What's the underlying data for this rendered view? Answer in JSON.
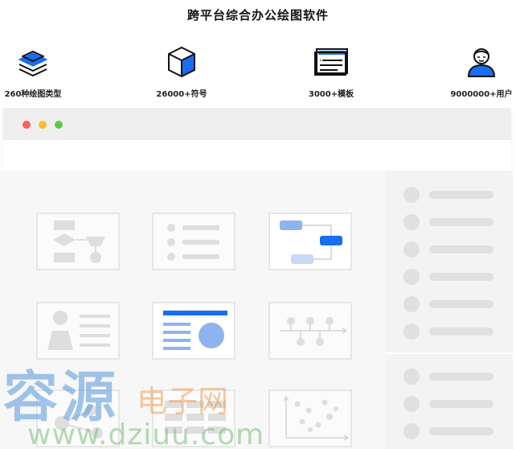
{
  "header": {
    "title": "跨平台综合办公绘图软件"
  },
  "features": [
    {
      "icon": "layers-icon",
      "label": "260种绘图类型"
    },
    {
      "icon": "cube-icon",
      "label": "26000+符号"
    },
    {
      "icon": "template-icon",
      "label": "3000+模板"
    },
    {
      "icon": "user-icon",
      "label": "9000000+用户"
    }
  ],
  "window": {
    "controls": [
      "close-dot",
      "minimize-dot",
      "maximize-dot"
    ],
    "colors": {
      "close": "#ff5f57",
      "minimize": "#febc2e",
      "maximize": "#62c93f"
    }
  },
  "templates": [
    {
      "icon": "flowchart-icon"
    },
    {
      "icon": "list-icon"
    },
    {
      "icon": "mindmap-icon"
    },
    {
      "icon": "profile-icon"
    },
    {
      "icon": "presentation-icon"
    },
    {
      "icon": "timeline-icon"
    },
    {
      "icon": "network-icon"
    },
    {
      "icon": "table-icon"
    },
    {
      "icon": "scatter-icon"
    }
  ],
  "watermark": {
    "big": "容源",
    "small": "电子网",
    "url": "www.dziuu.com"
  },
  "colors": {
    "accent": "#1a6cf0",
    "light_accent": "#8fb3ee",
    "muted": "#e1e1e1"
  }
}
